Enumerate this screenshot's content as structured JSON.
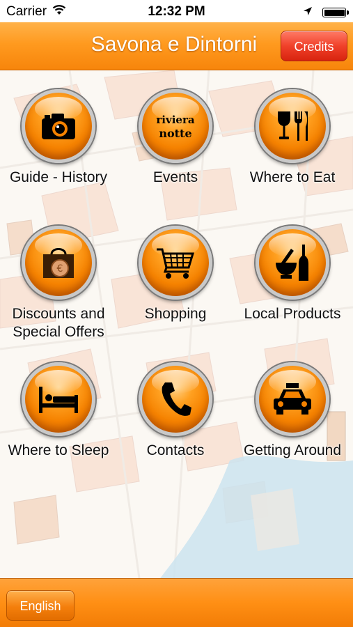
{
  "status_bar": {
    "carrier": "Carrier",
    "time": "12:32 PM",
    "battery_level": 1.0
  },
  "nav": {
    "title": "Savona e Dintorni",
    "credits_label": "Credits"
  },
  "grid": [
    {
      "label": "Guide - History",
      "icon": "camera-icon"
    },
    {
      "label": "Events",
      "icon": "riviera-notte-logo-icon",
      "logo_text": "riviera notte"
    },
    {
      "label": "Where to Eat",
      "icon": "wine-fork-knife-icon"
    },
    {
      "label": "Discounts and Special Offers",
      "icon": "shopping-bag-coin-icon"
    },
    {
      "label": "Shopping",
      "icon": "shopping-cart-icon"
    },
    {
      "label": "Local Products",
      "icon": "mortar-bottle-icon"
    },
    {
      "label": "Where to Sleep",
      "icon": "bed-icon"
    },
    {
      "label": "Contacts",
      "icon": "phone-icon"
    },
    {
      "label": "Getting Around",
      "icon": "taxi-icon"
    }
  ],
  "bottom": {
    "language_label": "English"
  },
  "colors": {
    "accent": "#ff9a1f",
    "credits": "#e5321b",
    "orb": "#f58200"
  }
}
